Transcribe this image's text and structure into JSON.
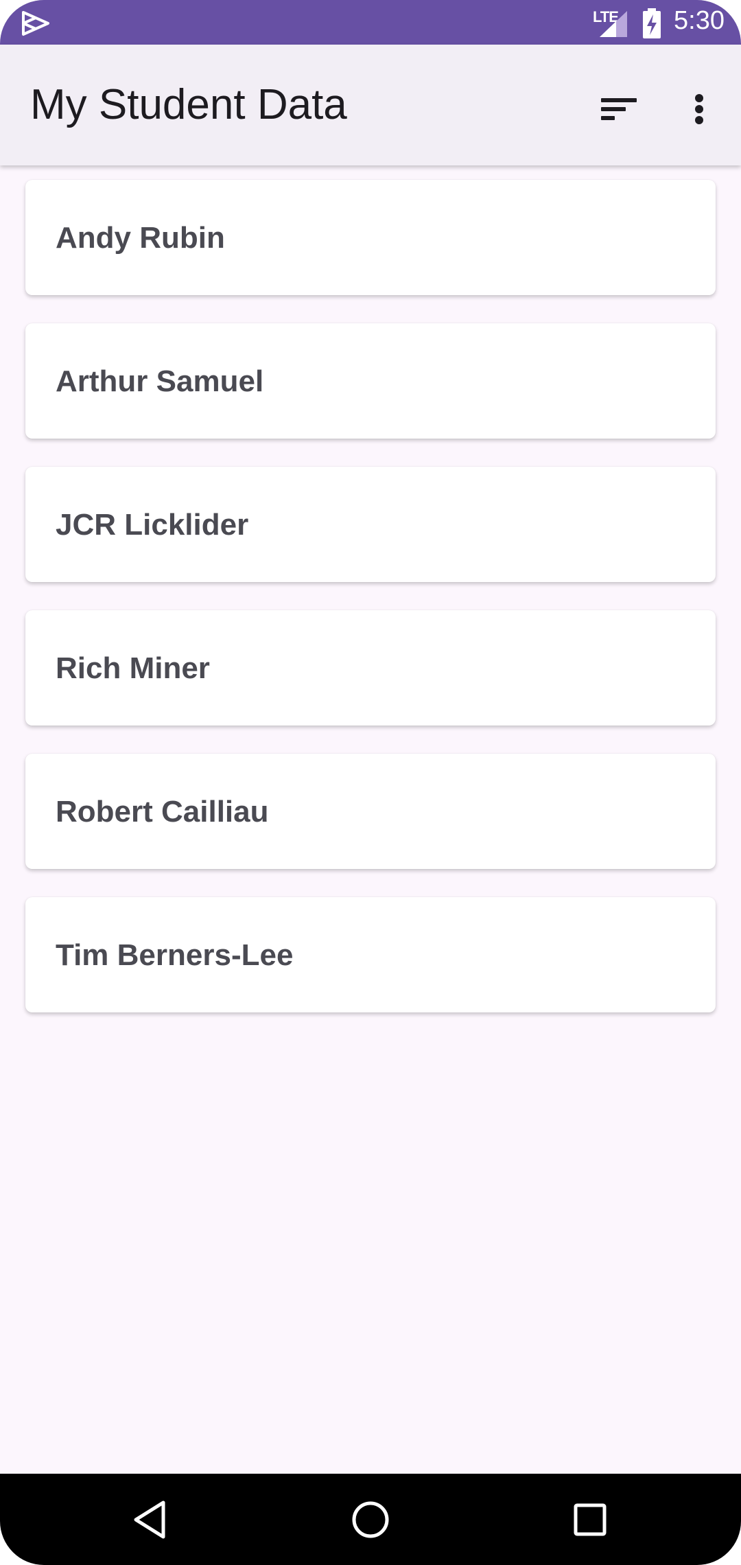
{
  "status_bar": {
    "network_label": "LTE",
    "time": "5:30",
    "left_icon": "play-protect-icon",
    "color": "#6750a4"
  },
  "app_bar": {
    "title": "My Student Data",
    "sort_icon": "sort-icon",
    "menu_icon": "more-vert-icon"
  },
  "students": [
    {
      "name": "Andy Rubin"
    },
    {
      "name": "Arthur Samuel"
    },
    {
      "name": "JCR Licklider"
    },
    {
      "name": "Rich Miner"
    },
    {
      "name": "Robert Cailliau"
    },
    {
      "name": "Tim Berners-Lee"
    }
  ],
  "nav_bar": {
    "back_icon": "back-triangle-icon",
    "home_icon": "home-circle-icon",
    "recents_icon": "recents-square-icon"
  },
  "colors": {
    "primary": "#6750a4",
    "app_bar_bg": "#f2eef5",
    "screen_bg": "#fcf6fd",
    "card_text": "#4a4a52"
  }
}
